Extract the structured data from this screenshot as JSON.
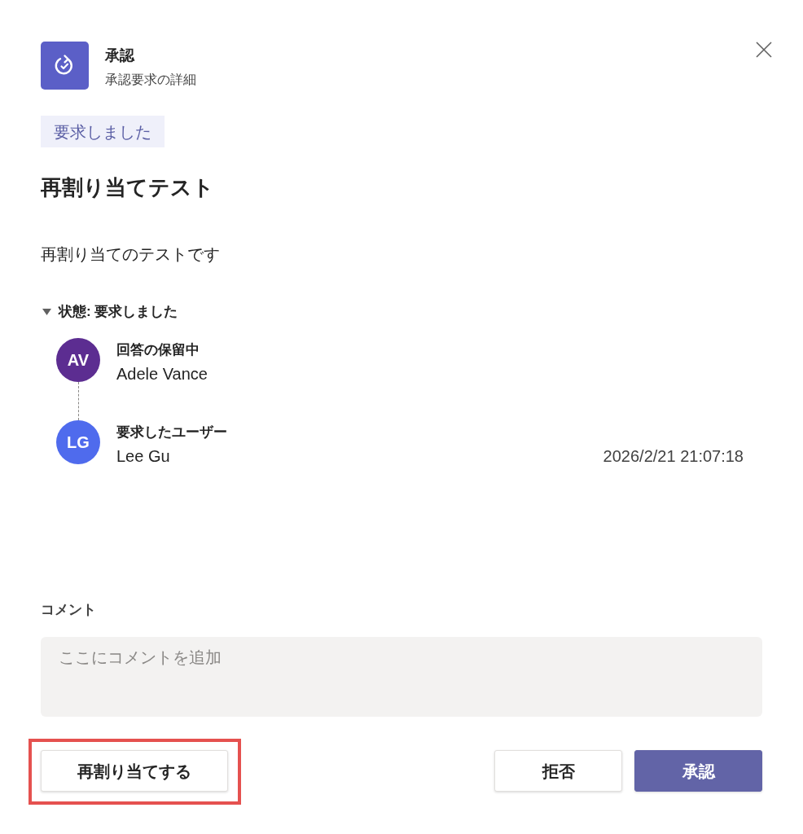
{
  "header": {
    "title": "承認",
    "subtitle": "承認要求の詳細"
  },
  "status_badge": "要求しました",
  "request": {
    "title": "再割り当てテスト",
    "description": "再割り当てのテストです"
  },
  "status_section": {
    "label": "状態: 要求しました",
    "expanded": true,
    "people": [
      {
        "initials": "AV",
        "color": "#5c2d91",
        "role": "回答の保留中",
        "name": "Adele Vance"
      },
      {
        "initials": "LG",
        "color": "#4f6bed",
        "role": "要求したユーザー",
        "name": "Lee Gu",
        "time": "2026/2/21 21:07:18"
      }
    ]
  },
  "comment": {
    "label": "コメント",
    "placeholder": "ここにコメントを追加"
  },
  "buttons": [
    {
      "label": "再割り当てする",
      "kind": "secondary",
      "highlighted": true
    },
    {
      "label": "拒否",
      "kind": "secondary",
      "highlighted": false
    },
    {
      "label": "承認",
      "kind": "primary",
      "highlighted": false
    }
  ]
}
